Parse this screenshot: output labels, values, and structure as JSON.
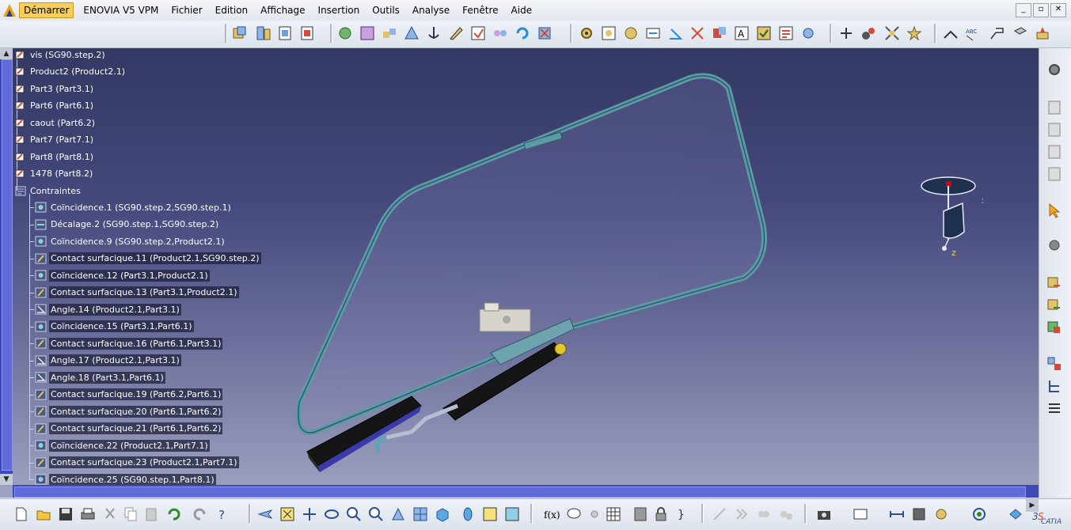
{
  "menubar": {
    "start": "Démarrer",
    "items": [
      "ENOVIA V5 VPM",
      "Fichier",
      "Edition",
      "Affichage",
      "Insertion",
      "Outils",
      "Analyse",
      "Fenêtre",
      "Aide"
    ]
  },
  "window_controls": [
    "_",
    "▫",
    "✕"
  ],
  "tree": {
    "products": [
      {
        "label": "vis (SG90.step.2)"
      },
      {
        "label": "Product2 (Product2.1)"
      },
      {
        "label": "Part3 (Part3.1)"
      },
      {
        "label": "Part6 (Part6.1)"
      },
      {
        "label": "caout (Part6.2)"
      },
      {
        "label": "Part7 (Part7.1)"
      },
      {
        "label": "Part8 (Part8.1)"
      },
      {
        "label": "1478 (Part8.2)"
      }
    ],
    "constraints_label": "Contraintes",
    "constraints": [
      {
        "label": "Coïncidence.1 (SG90.step.2,SG90.step.1)",
        "type": "coincidence"
      },
      {
        "label": "Décalage.2 (SG90.step.1,SG90.step.2)",
        "type": "offset"
      },
      {
        "label": "Coïncidence.9 (SG90.step.2,Product2.1)",
        "type": "coincidence"
      },
      {
        "label": "Contact surfacique.11 (Product2.1,SG90.step.2)",
        "type": "contact"
      },
      {
        "label": "Coïncidence.12 (Part3.1,Product2.1)",
        "type": "coincidence"
      },
      {
        "label": "Contact surfacique.13 (Part3.1,Product2.1)",
        "type": "contact"
      },
      {
        "label": "Angle.14 (Product2.1,Part3.1)",
        "type": "angle"
      },
      {
        "label": "Coïncidence.15 (Part3.1,Part6.1)",
        "type": "coincidence"
      },
      {
        "label": "Contact surfacique.16 (Part6.1,Part3.1)",
        "type": "contact"
      },
      {
        "label": "Angle.17 (Product2.1,Part3.1)",
        "type": "angle"
      },
      {
        "label": "Angle.18 (Part3.1,Part6.1)",
        "type": "angle"
      },
      {
        "label": "Contact surfacique.19 (Part6.2,Part6.1)",
        "type": "contact"
      },
      {
        "label": "Contact surfacique.20 (Part6.1,Part6.2)",
        "type": "contact"
      },
      {
        "label": "Contact surfacique.21 (Part6.1,Part6.2)",
        "type": "contact"
      },
      {
        "label": "Coïncidence.22 (Product2.1,Part7.1)",
        "type": "coincidence"
      },
      {
        "label": "Contact surfacique.23 (Product2.1,Part7.1)",
        "type": "contact"
      },
      {
        "label": "Coïncidence.25 (SG90.step.1,Part8.1)",
        "type": "coincidence"
      }
    ]
  },
  "compass": {
    "x": "x",
    "y": "y",
    "z": "z"
  },
  "axes": {
    "x": "x",
    "y": "y"
  },
  "brand": "CATIA",
  "colors": {
    "viewport_top": "#343863",
    "viewport_bottom": "#9fa3c0",
    "glass_frame": "#5b9aa6",
    "tree_text": "#ffffff"
  }
}
